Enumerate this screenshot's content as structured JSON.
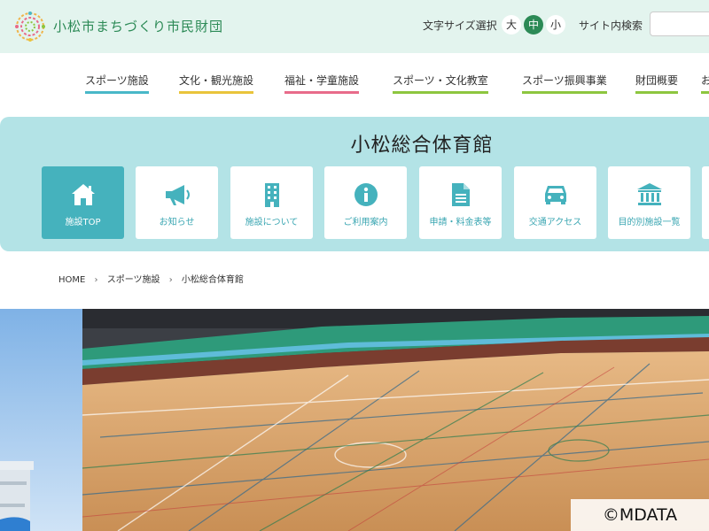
{
  "header": {
    "org_name": "小松市まちづくり市民財団",
    "font_size_label": "文字サイズ選択",
    "font_size_options": [
      "大",
      "中",
      "小"
    ],
    "font_size_selected": "中",
    "search_label": "サイト内検索",
    "search_value": ""
  },
  "nav": {
    "items": [
      {
        "label": "スポーツ施設",
        "color": "#49b8c8"
      },
      {
        "label": "文化・観光施設",
        "color": "#e9c43b"
      },
      {
        "label": "福祉・学童施設",
        "color": "#e86b8a"
      },
      {
        "label": "スポーツ・文化教室",
        "color": "#8dc63f"
      },
      {
        "label": "スポーツ振興事業",
        "color": "#8dc63f"
      },
      {
        "label": "財団概要",
        "color": "#8dc63f"
      },
      {
        "label": "お",
        "color": "#8dc63f"
      }
    ]
  },
  "facility": {
    "title": "小松総合体育館",
    "tabs": [
      {
        "label": "施設TOP",
        "icon": "home-icon"
      },
      {
        "label": "お知らせ",
        "icon": "megaphone-icon"
      },
      {
        "label": "施設について",
        "icon": "building-icon"
      },
      {
        "label": "ご利用案内",
        "icon": "info-icon"
      },
      {
        "label": "申請・料金表等",
        "icon": "document-icon"
      },
      {
        "label": "交通アクセス",
        "icon": "car-icon"
      },
      {
        "label": "目的別施設一覧",
        "icon": "institution-icon"
      }
    ]
  },
  "breadcrumb": [
    "HOME",
    "スポーツ施設",
    "小松総合体育館"
  ],
  "hero": {
    "copyright": "©MDATA"
  },
  "colors": {
    "brand_green": "#2c8a56",
    "teal": "#45b2bd",
    "band": "#b3e3e6",
    "header_bg": "#e3f4ee"
  }
}
